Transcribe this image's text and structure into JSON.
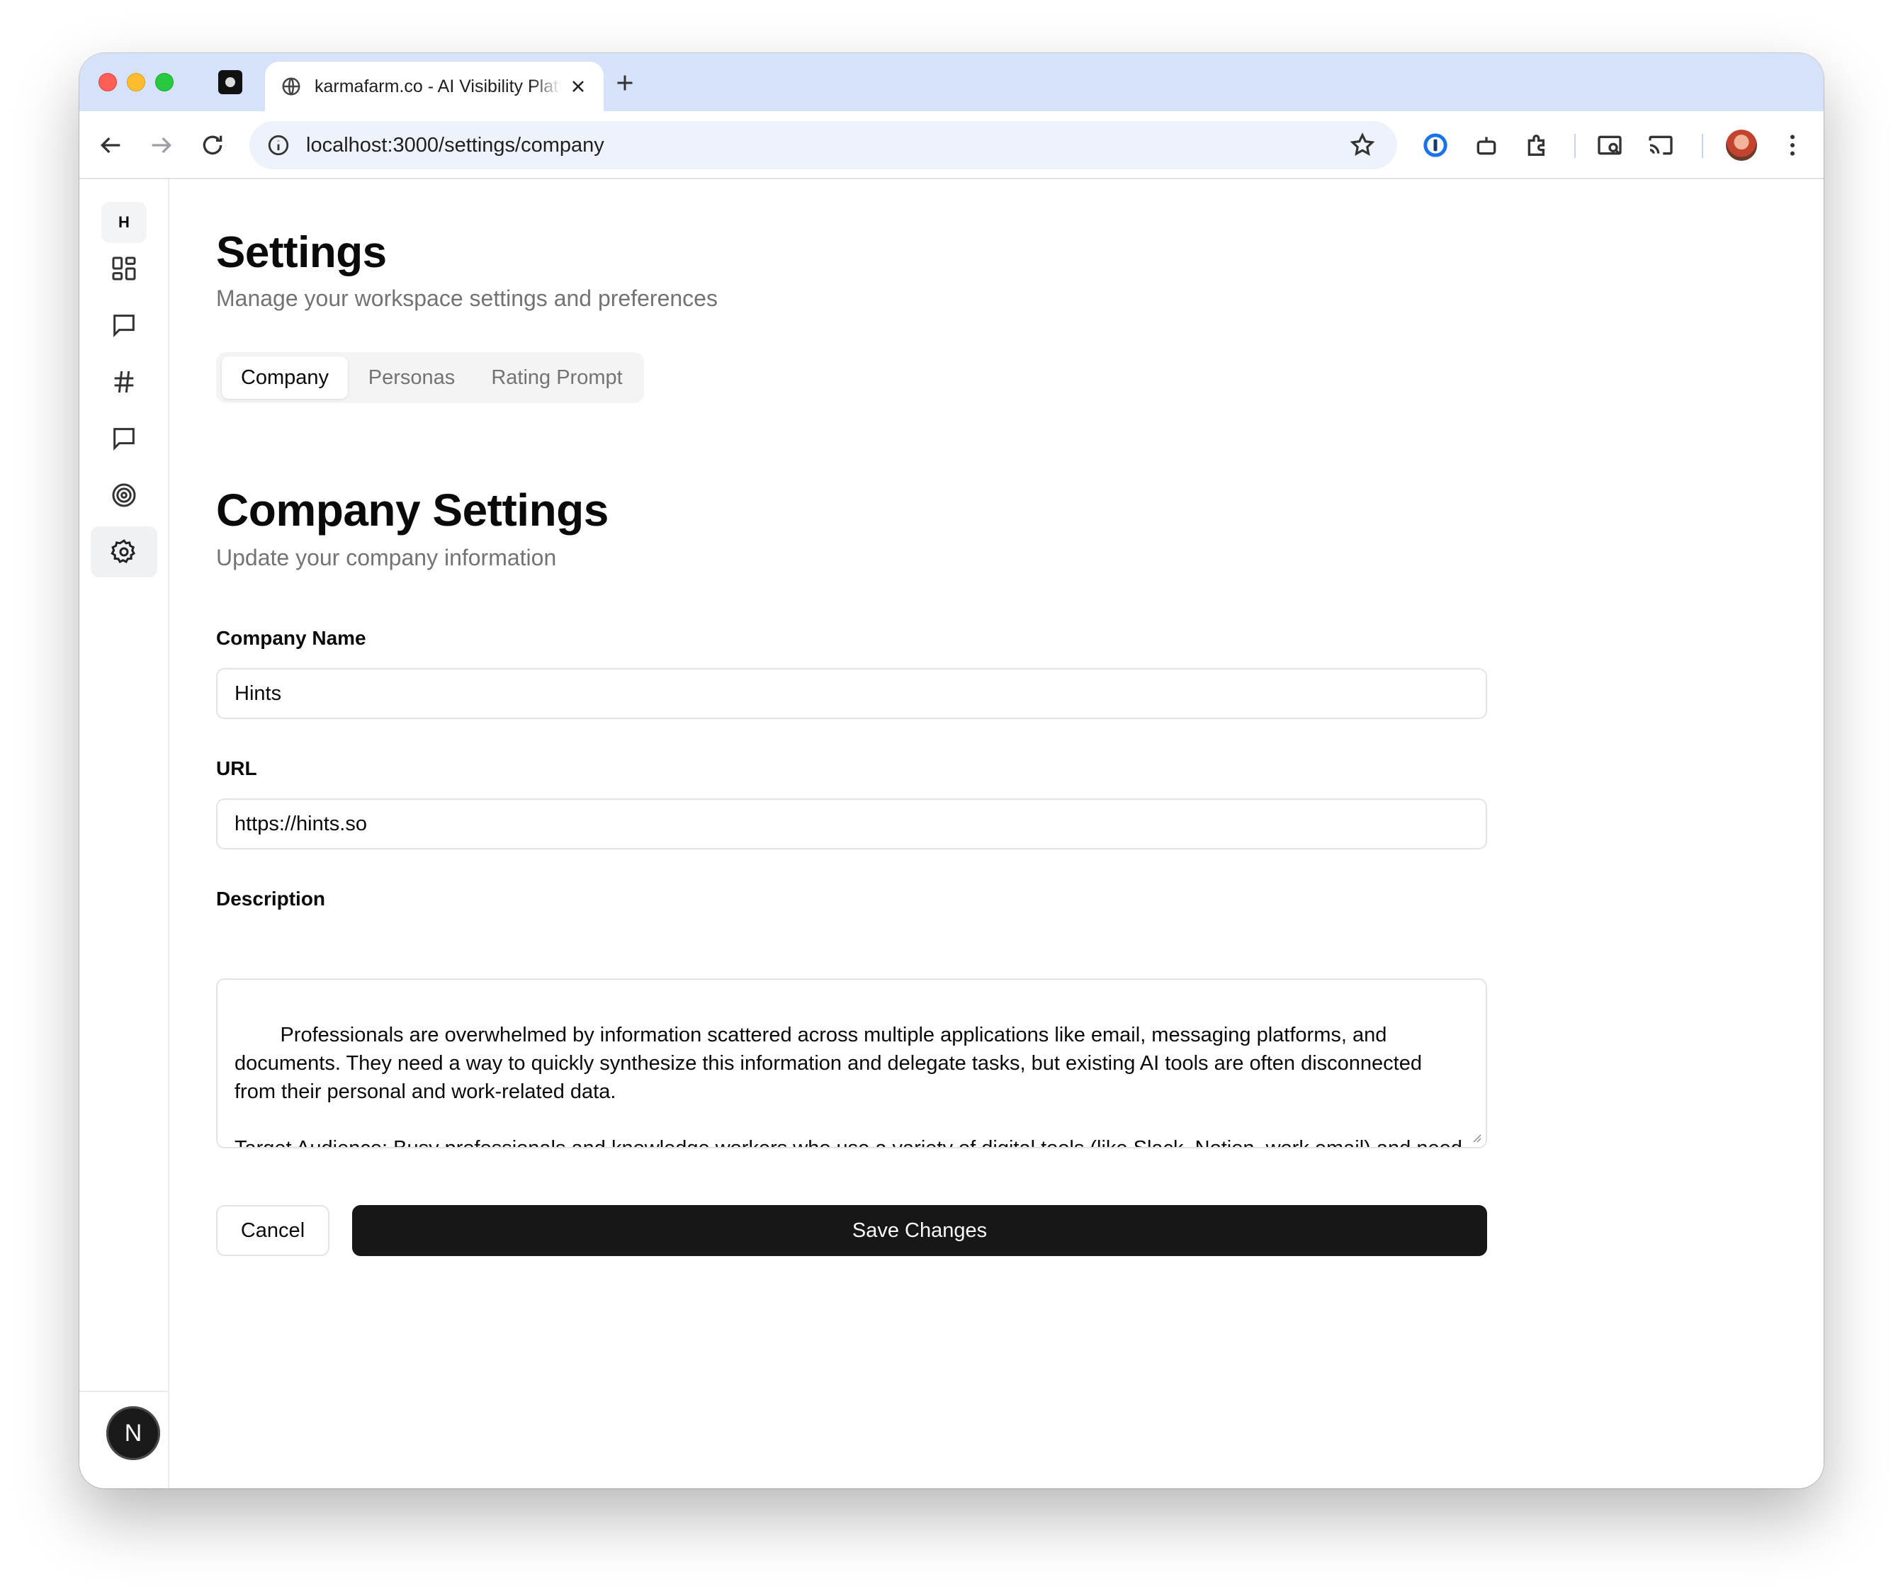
{
  "browser": {
    "tab_title": "karmafarm.co - AI Visibility Platform",
    "url": "localhost:3000/settings/company"
  },
  "sidebar": {
    "workspace_initial": "H",
    "items": [
      {
        "icon": "dashboard-icon"
      },
      {
        "icon": "chat-icon"
      },
      {
        "icon": "hash-icon"
      },
      {
        "icon": "message-icon"
      },
      {
        "icon": "target-icon"
      },
      {
        "icon": "settings-icon",
        "active": true
      }
    ],
    "user_initial": "N"
  },
  "header": {
    "title": "Settings",
    "subtitle": "Manage your workspace settings and preferences"
  },
  "tabs": [
    {
      "label": "Company",
      "active": true
    },
    {
      "label": "Personas"
    },
    {
      "label": "Rating Prompt"
    }
  ],
  "section": {
    "title": "Company Settings",
    "subtitle": "Update your company information"
  },
  "form": {
    "company_name_label": "Company Name",
    "company_name_value": "Hints",
    "url_label": "URL",
    "url_value": "https://hints.so",
    "description_label": "Description",
    "description_value": "Professionals are overwhelmed by information scattered across multiple applications like email, messaging platforms, and documents. They need a way to quickly synthesize this information and delegate tasks, but existing AI tools are often disconnected from their personal and work-related data.\n\nTarget Audience: Busy professionals and knowledge workers who use a variety of digital tools (like Slack, Notion, work email) and need an intelligent assistant to help manage information, automate tasks, and improve productivity.",
    "cancel_label": "Cancel",
    "save_label": "Save Changes"
  }
}
